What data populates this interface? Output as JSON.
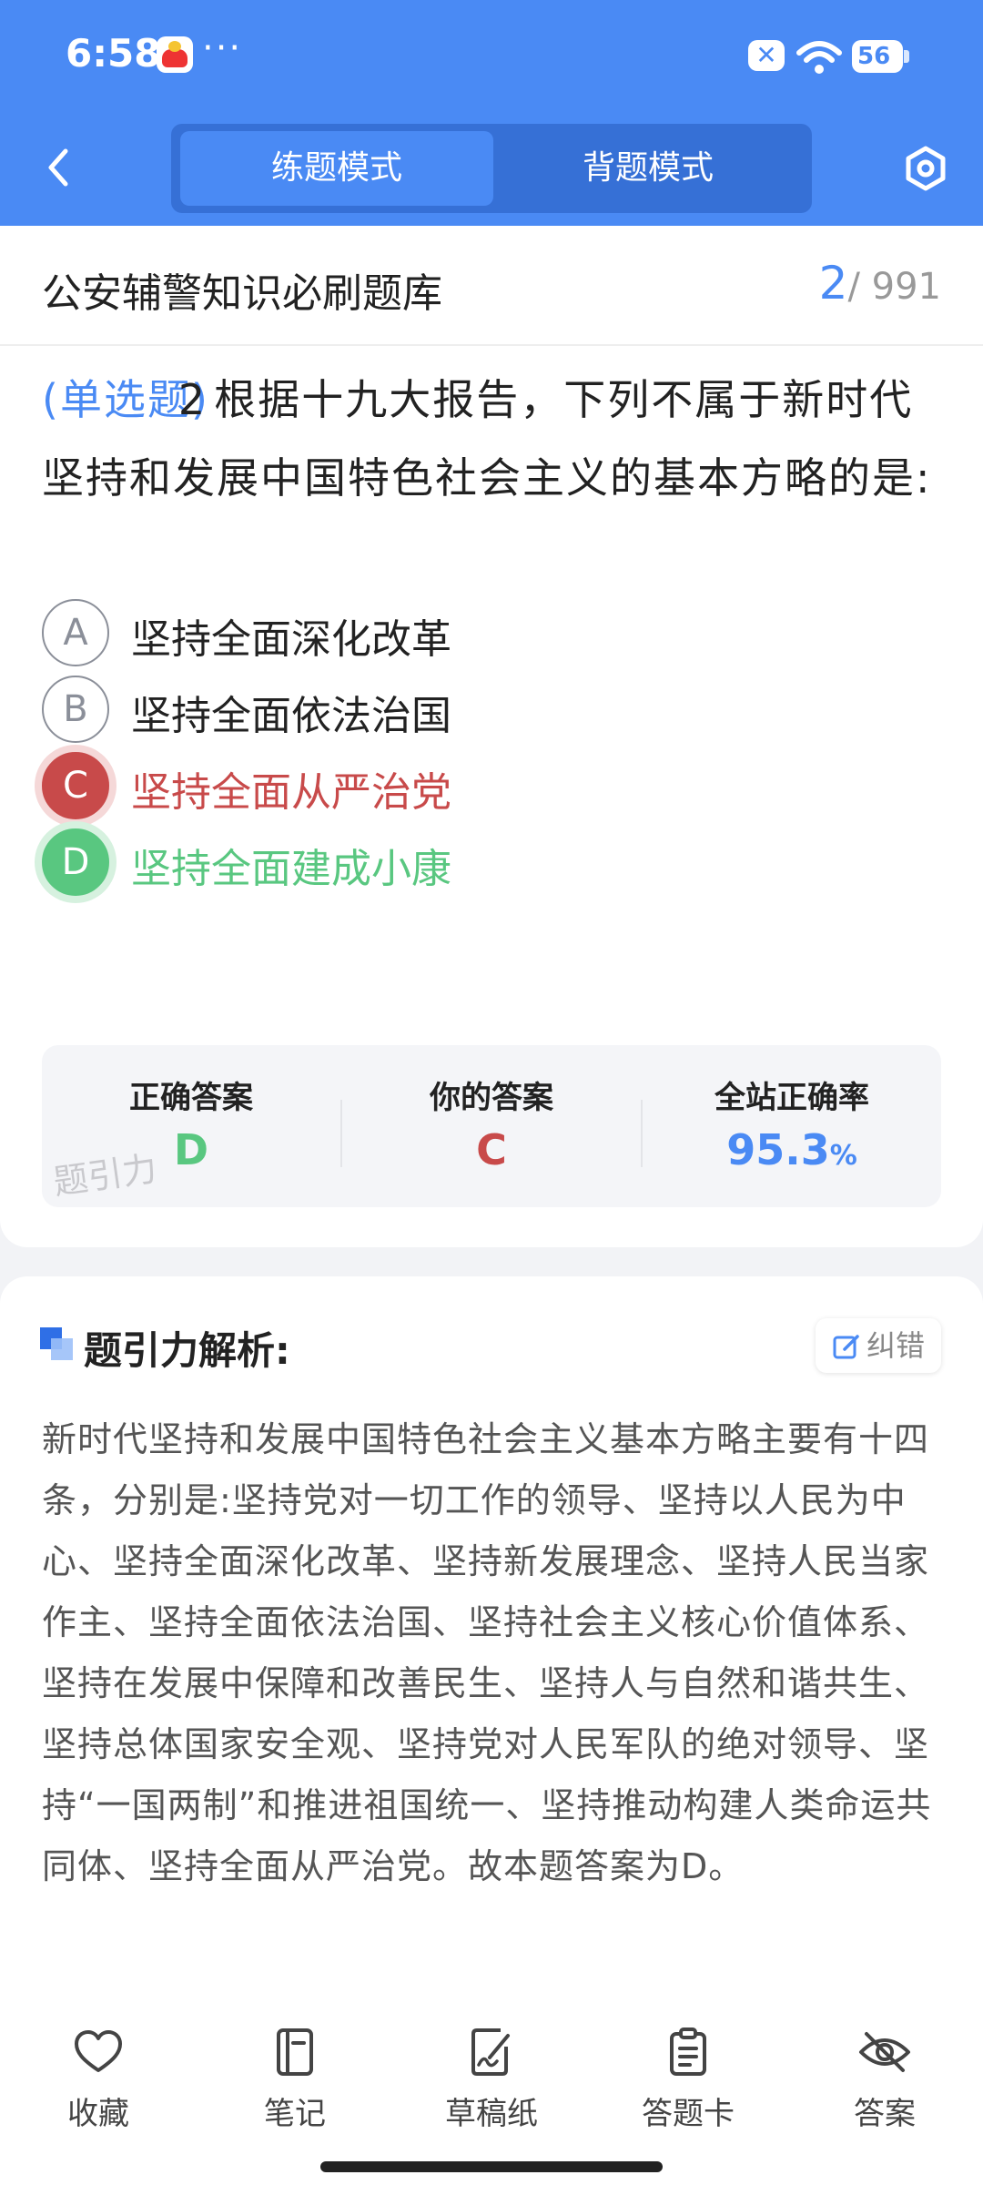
{
  "status_bar": {
    "time": "6:58",
    "dots": "···",
    "battery": "56"
  },
  "header": {
    "modes": [
      {
        "label": "练题模式",
        "active": true
      },
      {
        "label": "背题模式",
        "active": false
      }
    ]
  },
  "question_card": {
    "bank_title": "公安辅警知识必刷题库",
    "current": "2",
    "total": "/ 991",
    "type_label": "(单选题)",
    "number": "2",
    "stem": "根据十九大报告，下列不属于新时代坚持和发展中国特色社会主义的基本方略的是:",
    "options": [
      {
        "letter": "A",
        "text": "坚持全面深化改革",
        "state": "normal"
      },
      {
        "letter": "B",
        "text": "坚持全面依法治国",
        "state": "normal"
      },
      {
        "letter": "C",
        "text": "坚持全面从严治党",
        "state": "wrong"
      },
      {
        "letter": "D",
        "text": "坚持全面建成小康",
        "state": "correct"
      }
    ],
    "answers": {
      "correct_label": "正确答案",
      "correct_value": "D",
      "yours_label": "你的答案",
      "yours_value": "C",
      "rate_label": "全站正确率",
      "rate_value": "95.3",
      "rate_unit": "%",
      "watermark": "题引力"
    },
    "colors": {
      "accent": "#4a8af4",
      "wrong": "#c84a4a",
      "correct": "#59c780"
    }
  },
  "analysis": {
    "title": "题引力解析:",
    "report_label": "纠错",
    "body": "新时代坚持和发展中国特色社会主义基本方略主要有十四条，分别是:坚持党对一切工作的领导、坚持以人民为中心、坚持全面深化改革、坚持新发展理念、坚持人民当家作主、坚持全面依法治国、坚持社会主义核心价值体系、坚持在发展中保障和改善民生、坚持人与自然和谐共生、坚持总体国家安全观、坚持党对人民军队的绝对领导、坚持“一国两制”和推进祖国统一、坚持推动构建人类命运共同体、坚持全面从严治党。故本题答案为D。"
  },
  "bottom_nav": [
    {
      "label": "收藏",
      "icon": "heart-icon"
    },
    {
      "label": "笔记",
      "icon": "notebook-icon"
    },
    {
      "label": "草稿纸",
      "icon": "draft-paper-icon"
    },
    {
      "label": "答题卡",
      "icon": "answer-card-icon"
    },
    {
      "label": "答案",
      "icon": "eye-off-icon"
    }
  ]
}
